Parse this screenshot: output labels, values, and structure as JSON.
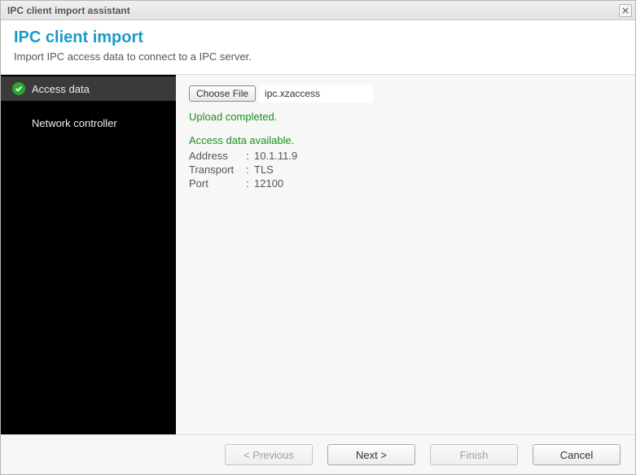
{
  "window": {
    "title": "IPC client import assistant"
  },
  "header": {
    "title": "IPC client import",
    "subtitle": "Import IPC access data to connect to a IPC server."
  },
  "sidebar": {
    "items": [
      {
        "label": "Access data",
        "active": true,
        "checked": true
      },
      {
        "label": "Network controller",
        "active": false,
        "checked": false
      }
    ]
  },
  "content": {
    "choose_file_label": "Choose File",
    "file_name": "ipc.xzaccess",
    "upload_status": "Upload completed.",
    "access_available": "Access data available.",
    "address_label": "Address",
    "address_value": "10.1.11.9",
    "transport_label": "Transport",
    "transport_value": "TLS",
    "port_label": "Port",
    "port_value": "12100"
  },
  "footer": {
    "previous": "< Previous",
    "next": "Next >",
    "finish": "Finish",
    "cancel": "Cancel"
  }
}
